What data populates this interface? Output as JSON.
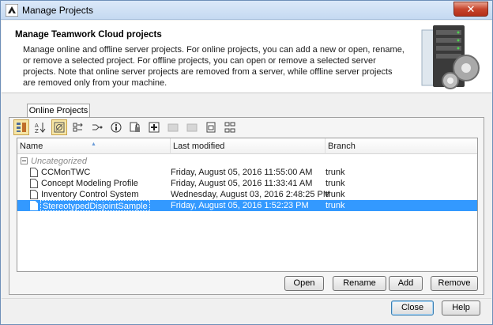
{
  "window": {
    "title": "Manage Projects",
    "close_glyph": "✕"
  },
  "header": {
    "title": "Manage Teamwork Cloud projects",
    "description": "Manage online and offline server projects. For online projects, you can add a new or open, rename, or remove a selected project. For offline projects, you can open or remove a selected server projects. Note that online server projects are removed from a server, while offline server projects are removed only from your machine."
  },
  "tabs": [
    {
      "label": "Online Projects",
      "active": true
    }
  ],
  "toolbar": [
    {
      "icon": "group-by-category-icon",
      "pressed": true
    },
    {
      "icon": "sort-az-icon",
      "pressed": false
    },
    {
      "icon": "filter-icon",
      "pressed": true
    },
    {
      "icon": "branch-compare-icon",
      "pressed": false
    },
    {
      "icon": "branch-merge-icon",
      "pressed": false
    },
    {
      "icon": "info-icon",
      "pressed": false
    },
    {
      "icon": "project-lock-icon",
      "pressed": false
    },
    {
      "icon": "add-category-icon",
      "pressed": false
    },
    {
      "icon": "disabled-action-icon",
      "pressed": false
    },
    {
      "icon": "disabled-action-icon",
      "pressed": false
    },
    {
      "icon": "document-open-icon",
      "pressed": false
    },
    {
      "icon": "hierarchy-icon",
      "pressed": false
    }
  ],
  "table": {
    "columns": [
      "Name",
      "Last modified",
      "Branch"
    ],
    "group": "Uncategorized",
    "rows": [
      {
        "name": "CCMonTWC",
        "modified": "Friday, August 05, 2016 11:55:00 AM",
        "branch": "trunk",
        "selected": false
      },
      {
        "name": "Concept Modeling Profile",
        "modified": "Friday, August 05, 2016 11:33:41 AM",
        "branch": "trunk",
        "selected": false
      },
      {
        "name": "Inventory Control System",
        "modified": "Wednesday, August 03, 2016 2:48:25 PM",
        "branch": "trunk",
        "selected": false
      },
      {
        "name": "StereotypedDisjointSample",
        "modified": "Friday, August 05, 2016 1:52:23 PM",
        "branch": "trunk",
        "selected": true
      }
    ]
  },
  "actions": {
    "open": "Open",
    "rename": "Rename",
    "add": "Add",
    "remove": "Remove"
  },
  "footer": {
    "close": "Close",
    "help": "Help"
  },
  "colors": {
    "selection": "#3399ff",
    "title_bar": "#c5d9f1",
    "close_button": "#c7452c"
  }
}
